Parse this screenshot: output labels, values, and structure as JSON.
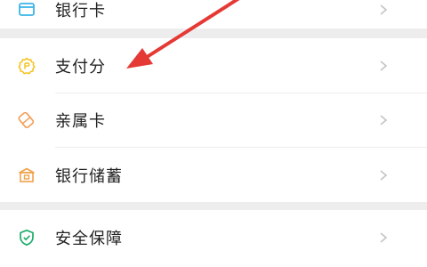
{
  "colors": {
    "background": "#ededed",
    "card": "#ffffff",
    "text": "#222222",
    "chevron": "#c4c4c4",
    "icon_bank_card": "#3bb4e8",
    "icon_pay_score": "#f4c21a",
    "icon_family_card": "#f2a05a",
    "icon_bank_savings": "#f0a24a",
    "icon_security": "#1aad6a",
    "annotation_arrow": "#e53935"
  },
  "menu_top": {
    "bank_card": {
      "label": "银行卡",
      "icon": "bank-card-icon"
    }
  },
  "menu_mid": {
    "pay_score": {
      "label": "支付分",
      "icon": "pay-score-icon"
    },
    "family_card": {
      "label": "亲属卡",
      "icon": "family-card-icon"
    },
    "bank_savings": {
      "label": "银行储蓄",
      "icon": "bank-savings-icon"
    }
  },
  "menu_bot": {
    "security": {
      "label": "安全保障",
      "icon": "security-shield-icon"
    }
  }
}
